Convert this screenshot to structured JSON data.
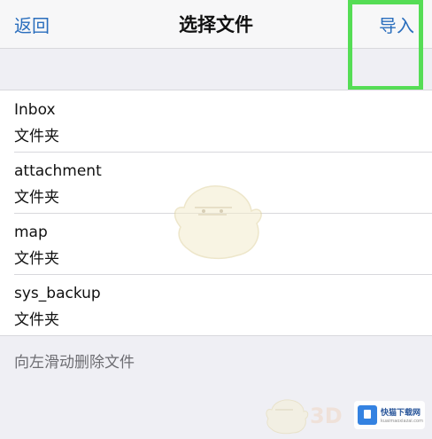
{
  "nav": {
    "back_label": "返回",
    "title": "选择文件",
    "import_label": "导入"
  },
  "files": [
    {
      "name": "Inbox",
      "type": "文件夹"
    },
    {
      "name": "attachment",
      "type": "文件夹"
    },
    {
      "name": "map",
      "type": "文件夹"
    },
    {
      "name": "sys_backup",
      "type": "文件夹"
    }
  ],
  "hint": "向左滑动删除文件",
  "watermark": {
    "brand": "快猫下载网",
    "brand_url": "kuaimaoxiazai.com",
    "mark_3d": "3D"
  },
  "colors": {
    "accent": "#2a6ebd",
    "highlight": "#55dd55",
    "background": "#efeff4"
  }
}
